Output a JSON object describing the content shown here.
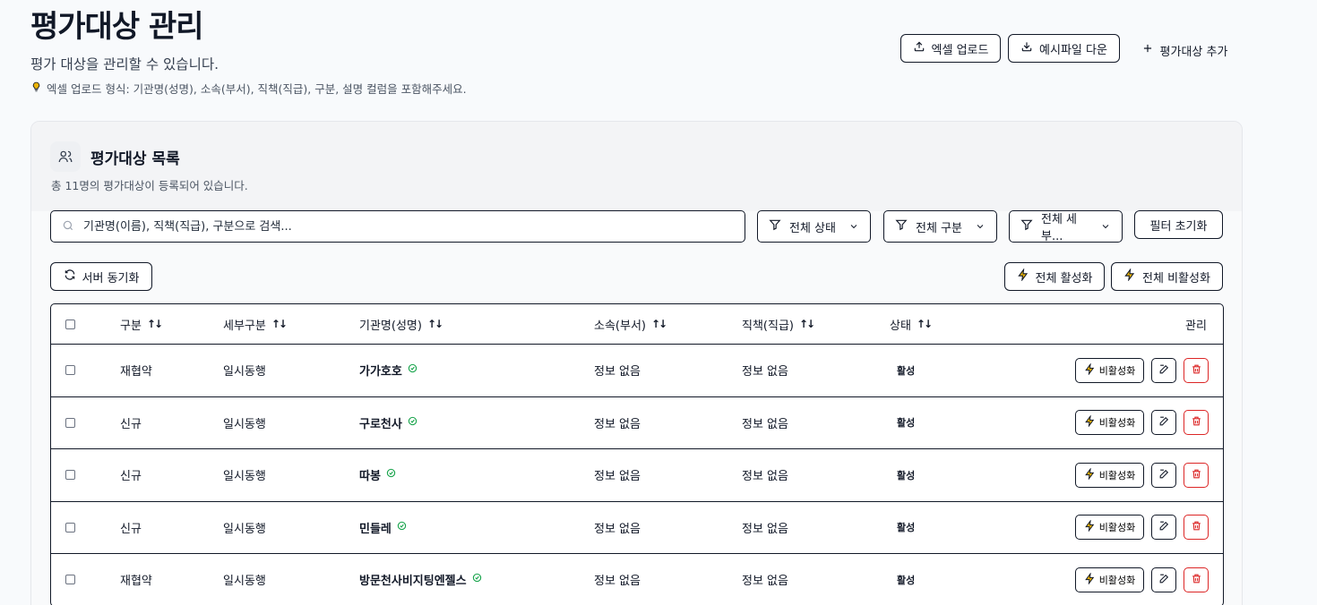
{
  "header": {
    "title": "평가대상 관리",
    "subtitle": "평가 대상을 관리할 수 있습니다.",
    "hint": "엑셀 업로드 형식: 기관명(성명), 소속(부서), 직책(직급), 구분, 설명 컬럼을 포함해주세요.",
    "excel_upload_label": "엑셀 업로드",
    "sample_download_label": "예시파일 다운",
    "add_target_label": "평가대상 추가"
  },
  "card": {
    "title": "평가대상 목록",
    "subtitle": "총 11명의 평가대상이 등록되어 있습니다."
  },
  "filters": {
    "search_placeholder": "기관명(이름), 직책(직급), 구분으로 검색...",
    "status_value": "전체 상태",
    "category_value": "전체 구분",
    "subcategory_value": "전체 세부...",
    "reset_label": "필터 초기화"
  },
  "actions": {
    "sync_label": "서버 동기화",
    "activate_all_label": "전체 활성화",
    "deactivate_all_label": "전체 비활성화"
  },
  "table": {
    "columns": [
      "구분",
      "세부구분",
      "기관명(성명)",
      "소속(부서)",
      "직책(직급)",
      "상태",
      "관리"
    ],
    "deactivate_label": "비활성화",
    "rows": [
      {
        "category": "재협약",
        "subcategory": "일시동행",
        "name": "가가호호",
        "department": "정보 없음",
        "position": "정보 없음",
        "status": "활성"
      },
      {
        "category": "신규",
        "subcategory": "일시동행",
        "name": "구로천사",
        "department": "정보 없음",
        "position": "정보 없음",
        "status": "활성"
      },
      {
        "category": "신규",
        "subcategory": "일시동행",
        "name": "따봉",
        "department": "정보 없음",
        "position": "정보 없음",
        "status": "활성"
      },
      {
        "category": "신규",
        "subcategory": "일시동행",
        "name": "민들레",
        "department": "정보 없음",
        "position": "정보 없음",
        "status": "활성"
      },
      {
        "category": "재협약",
        "subcategory": "일시동행",
        "name": "방문천사비지팅엔젤스",
        "department": "정보 없음",
        "position": "정보 없음",
        "status": "활성"
      }
    ]
  },
  "colors": {
    "accent": "#111827",
    "active_check": "#16a34a",
    "delete": "#dc2626",
    "bulb": "#eab308"
  }
}
